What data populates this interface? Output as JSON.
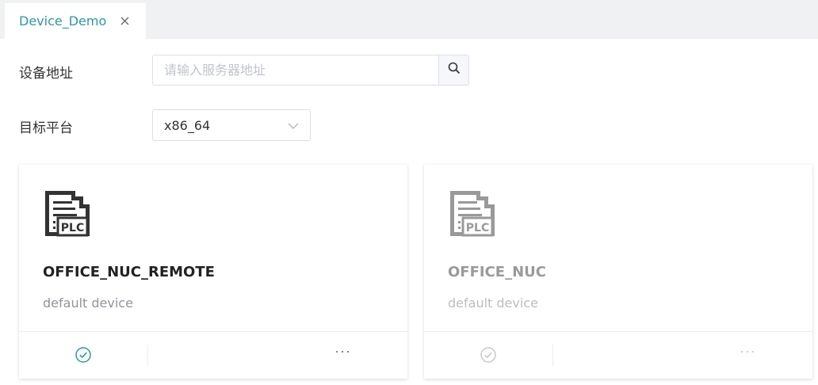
{
  "tabs": [
    {
      "label": "Device_Demo"
    }
  ],
  "form": {
    "address_label": "设备地址",
    "address_placeholder": "请输入服务器地址",
    "address_value": "",
    "platform_label": "目标平台",
    "platform_value": "x86_64"
  },
  "devices": [
    {
      "name": "OFFICE_NUC_REMOTE",
      "description": "default device",
      "icon_text": "PLC",
      "status": "active"
    },
    {
      "name": "OFFICE_NUC",
      "description": "default device",
      "icon_text": "PLC",
      "status": "inactive"
    }
  ],
  "icons": {
    "tab_close": "close-icon",
    "search": "search-icon",
    "select_arrow": "chevron-down-icon",
    "device": "plc-device-icon",
    "check": "check-circle-icon",
    "more": "more-icon"
  },
  "colors": {
    "accent": "#2a9a9e",
    "inactive": "#9a9a9a",
    "tabbar_bg": "#f0f1f3"
  },
  "more_glyph": "···"
}
